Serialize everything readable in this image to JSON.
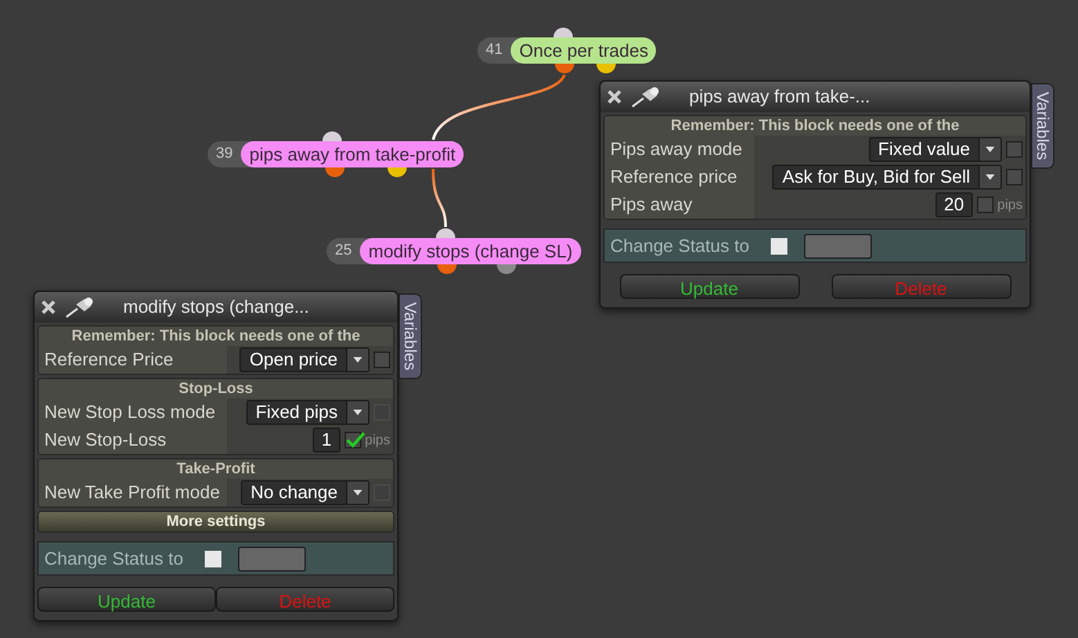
{
  "nodes": [
    {
      "number": "41",
      "label": "Once per trades",
      "color": "#b5e48c",
      "ports": [
        {
          "color": "#e8600c"
        },
        {
          "color": "#e8c000"
        }
      ]
    },
    {
      "number": "39",
      "label": "pips away from take-profit",
      "color": "#f58cf5",
      "ports": [
        {
          "color": "#e8600c"
        },
        {
          "color": "#e8c000"
        }
      ]
    },
    {
      "number": "25",
      "label": "modify stops (change SL)",
      "color": "#f58cf5",
      "ports": [
        {
          "color": "#e8600c"
        },
        {
          "color": "#8a8a8a"
        }
      ]
    }
  ],
  "panels": [
    {
      "title": "pips away from take-...",
      "tab": "Variables",
      "sections": [
        {
          "heading": "Remember: This block needs one of the",
          "expanded": true,
          "rows": [
            {
              "kind": "select",
              "label": "Pips away mode",
              "value": "Fixed value",
              "checked": false,
              "disabled": false
            },
            {
              "kind": "select",
              "label": "Reference price",
              "value": "Ask for Buy, Bid for Sell",
              "checked": false,
              "disabled": false
            },
            {
              "kind": "number",
              "label": "Pips away",
              "value": "20",
              "checked": false,
              "disabled": false,
              "unit": "pips"
            }
          ]
        }
      ],
      "status": {
        "label": "Change Status to",
        "checked": false
      },
      "buttons": [
        "Update",
        "Delete"
      ]
    },
    {
      "title": "modify stops (change...",
      "tab": "Variables",
      "sections": [
        {
          "heading": "Remember: This block needs one of the",
          "expanded": true,
          "rows": [
            {
              "kind": "select",
              "label": "Reference Price",
              "value": "Open price",
              "checked": false,
              "disabled": false
            }
          ]
        },
        {
          "heading": "Stop-Loss",
          "expanded": true,
          "rows": [
            {
              "kind": "select",
              "label": "New Stop Loss mode",
              "value": "Fixed pips",
              "checked": false,
              "disabled": true
            },
            {
              "kind": "number",
              "label": "New Stop-Loss",
              "value": "1",
              "checked": true,
              "disabled": false,
              "unit": "pips"
            }
          ]
        },
        {
          "heading": "Take-Profit",
          "expanded": true,
          "rows": [
            {
              "kind": "select",
              "label": "New Take Profit mode",
              "value": "No change",
              "checked": false,
              "disabled": true
            }
          ]
        },
        {
          "heading": "More settings",
          "expanded": false
        }
      ],
      "status": {
        "label": "Change Status to",
        "checked": false
      },
      "buttons": [
        "Update",
        "Delete"
      ]
    }
  ]
}
